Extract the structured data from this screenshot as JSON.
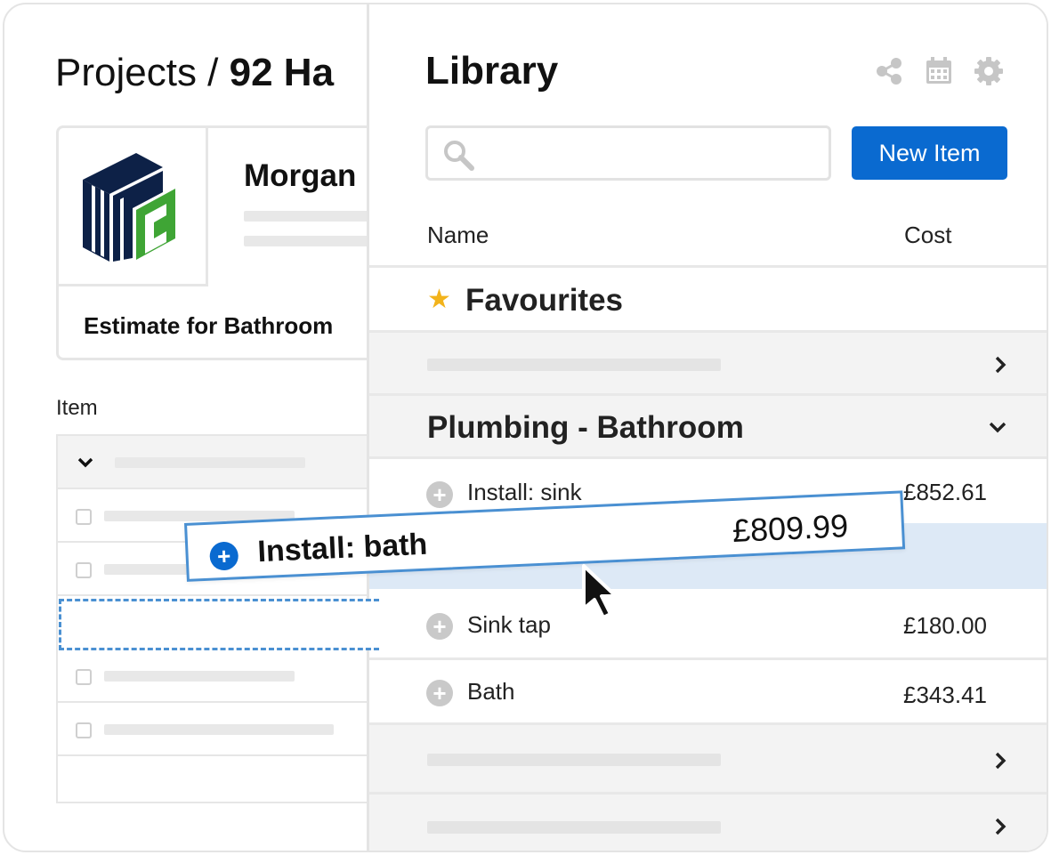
{
  "project": {
    "breadcrumb_prefix": "Projects /",
    "breadcrumb_current": "92 Ha",
    "client_name": "Morgan",
    "estimate_name": "Estimate for Bathroom",
    "item_column_label": "Item"
  },
  "library": {
    "title": "Library",
    "icons": [
      "share-icon",
      "calendar-icon",
      "gear-icon"
    ],
    "search_placeholder": "",
    "new_item_label": "New Item",
    "columns": {
      "name": "Name",
      "cost": "Cost"
    },
    "favourites_label": "Favourites",
    "category_label": "Plumbing - Bathroom",
    "items": [
      {
        "name": "Install: sink",
        "cost": "£852.61"
      },
      {
        "name": "Sink tap",
        "cost": "£180.00"
      },
      {
        "name": "Bath",
        "cost": "£343.41"
      }
    ]
  },
  "drag_item": {
    "name": "Install: bath",
    "cost": "£809.99"
  },
  "colors": {
    "accent": "#0a6ad0",
    "drag_border": "#4a90d2",
    "highlight_row": "#dde9f6",
    "star": "#f2b31b",
    "logo_navy": "#0d2147",
    "logo_green": "#3fa535"
  }
}
